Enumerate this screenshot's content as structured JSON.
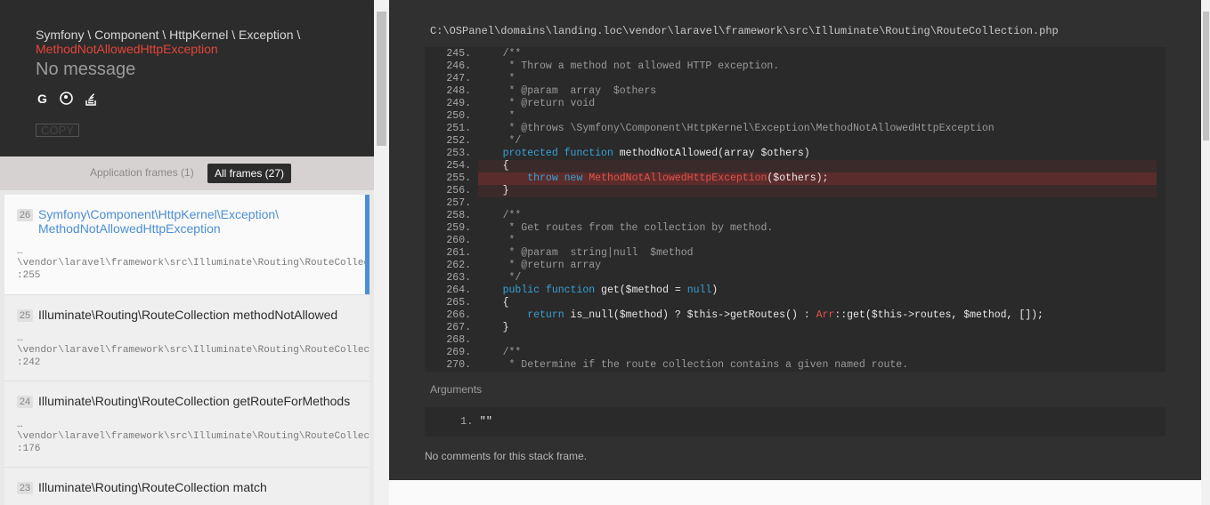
{
  "exception": {
    "class_prefix": "Symfony \\ Component \\ HttpKernel \\ Exception \\",
    "class_name": "MethodNotAllowedHttpException",
    "message": "No message"
  },
  "icons": [
    "google-icon",
    "duckduckgo-icon",
    "stackoverflow-icon"
  ],
  "copy_label": "COPY",
  "tabs": {
    "application": "Application frames (1)",
    "all": "All frames (27)"
  },
  "frames": [
    {
      "num": "26",
      "title": "Symfony\\Component\\HttpKernel\\Exception\\ MethodNotAllowedHttpException",
      "ellipsis": "…",
      "path": "\\vendor\\laravel\\framework\\src\\Illuminate\\Routing\\RouteCollect",
      "line": ":255"
    },
    {
      "num": "25",
      "title": "Illuminate\\Routing\\RouteCollection methodNotAllowed",
      "ellipsis": "…",
      "path": "\\vendor\\laravel\\framework\\src\\Illuminate\\Routing\\RouteCollect",
      "line": ":242"
    },
    {
      "num": "24",
      "title": "Illuminate\\Routing\\RouteCollection getRouteForMethods",
      "ellipsis": "…",
      "path": "\\vendor\\laravel\\framework\\src\\Illuminate\\Routing\\RouteCollect",
      "line": ":176"
    },
    {
      "num": "23",
      "title": "Illuminate\\Routing\\RouteCollection match",
      "ellipsis": "",
      "path": "",
      "line": ""
    }
  ],
  "file_path": "C:\\OSPanel\\domains\\landing.loc\\vendor\\laravel\\framework\\src\\Illuminate\\Routing\\RouteCollection.php",
  "code_lines": [
    {
      "n": "245.",
      "t": "    /**"
    },
    {
      "n": "246.",
      "t": "     * Throw a method not allowed HTTP exception."
    },
    {
      "n": "247.",
      "t": "     *"
    },
    {
      "n": "248.",
      "t": "     * @param  array  $others"
    },
    {
      "n": "249.",
      "t": "     * @return void"
    },
    {
      "n": "250.",
      "t": "     *"
    },
    {
      "n": "251.",
      "t": "     * @throws \\Symfony\\Component\\HttpKernel\\Exception\\MethodNotAllowedHttpException"
    },
    {
      "n": "252.",
      "t": "     */"
    },
    {
      "n": "253.",
      "t": "    protected function methodNotAllowed(array $others)"
    },
    {
      "n": "254.",
      "t": "    {"
    },
    {
      "n": "255.",
      "t": "        throw new MethodNotAllowedHttpException($others);"
    },
    {
      "n": "256.",
      "t": "    }"
    },
    {
      "n": "257.",
      "t": ""
    },
    {
      "n": "258.",
      "t": "    /**"
    },
    {
      "n": "259.",
      "t": "     * Get routes from the collection by method."
    },
    {
      "n": "260.",
      "t": "     *"
    },
    {
      "n": "261.",
      "t": "     * @param  string|null  $method"
    },
    {
      "n": "262.",
      "t": "     * @return array"
    },
    {
      "n": "263.",
      "t": "     */"
    },
    {
      "n": "264.",
      "t": "    public function get($method = null)"
    },
    {
      "n": "265.",
      "t": "    {"
    },
    {
      "n": "266.",
      "t": "        return is_null($method) ? $this->getRoutes() : Arr::get($this->routes, $method, []);"
    },
    {
      "n": "267.",
      "t": "    }"
    },
    {
      "n": "268.",
      "t": ""
    },
    {
      "n": "269.",
      "t": "    /**"
    },
    {
      "n": "270.",
      "t": "     * Determine if the route collection contains a given named route."
    }
  ],
  "arguments_label": "Arguments",
  "arguments": [
    {
      "n": "1.",
      "v": "\"\""
    }
  ],
  "no_comments": "No comments for this stack frame."
}
